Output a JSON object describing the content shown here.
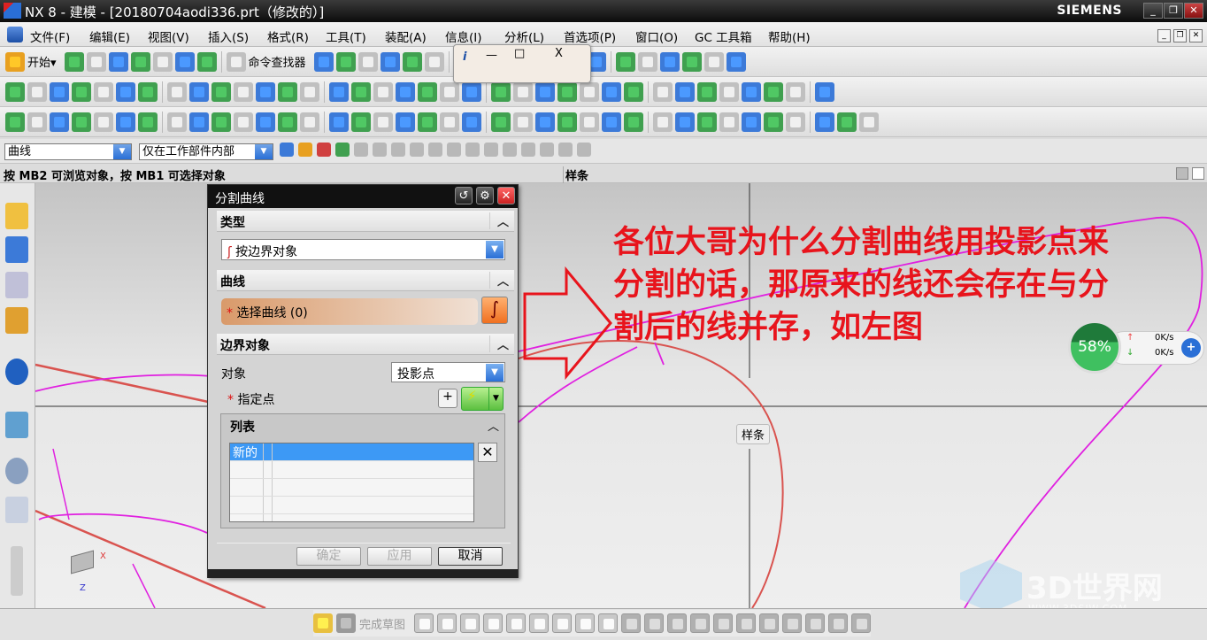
{
  "window": {
    "title": "NX 8 - 建模 - [20180704aodi336.prt（修改的）]",
    "brand": "SIEMENS",
    "min": "_",
    "max": "❐",
    "close": "✕"
  },
  "menu": [
    "文件(F)",
    "编辑(E)",
    "视图(V)",
    "插入(S)",
    "格式(R)",
    "工具(T)",
    "装配(A)",
    "信息(I)",
    "分析(L)",
    "首选项(P)",
    "窗口(O)",
    "GC 工具箱",
    "帮助(H)"
  ],
  "toolbar1": {
    "start": "开始▾",
    "finder": "命令查找器",
    "icons": [
      "new-icon",
      "open-icon",
      "save-icon",
      "save-as-icon",
      "cut-icon",
      "undo-icon",
      "redo-icon",
      "finder-icon",
      "sketch-icon",
      "line-icon",
      "arc-icon",
      "point-icon",
      "rect-icon",
      "spline-icon",
      "wave-icon",
      "polyline-icon",
      "polygon-icon",
      "curve-icon",
      "offset-icon",
      "trim-icon",
      "extend-icon",
      "project-icon",
      "bridge-icon",
      "chamfer-icon",
      "extrude-icon",
      "revolve-icon",
      "sweep-icon"
    ]
  },
  "toolbar2": {
    "icons": [
      "fit-icon",
      "shade-icon",
      "view-icon",
      "render-icon",
      "cube-icon",
      "cube2-icon",
      "cube3-icon",
      "layer-icon",
      "orient-icon",
      "wcs-icon",
      "surface-icon",
      "mesh-icon",
      "grid-icon",
      "swept-icon",
      "ruled-icon",
      "through-icon",
      "bound-icon",
      "patch-icon",
      "trim-surf-icon",
      "sew-icon",
      "layer2-icon",
      "layer3-icon",
      "section-icon",
      "analysis-icon",
      "move-icon",
      "rotate-icon",
      "mirror-icon",
      "scale-icon",
      "transform-icon",
      "measure-icon",
      "box-icon",
      "feature-icon",
      "feature2-icon",
      "feature3-icon",
      "feature4-icon",
      "feature5-icon"
    ]
  },
  "toolbar3": {
    "icons": [
      "curve-analyze-icon",
      "hole-icon",
      "pattern-icon",
      "stack-icon",
      "stack2-icon",
      "stack3-icon",
      "block-icon",
      "boolean-icon",
      "doc-icon",
      "door-icon",
      "table-icon",
      "sheet-icon",
      "box2-icon",
      "solid-icon",
      "blend-icon",
      "thicken-icon",
      "shell-icon",
      "draft-icon",
      "unite-icon",
      "subtract-icon",
      "intersect-icon",
      "sew2-icon",
      "split-icon",
      "offset2-icon",
      "extract-icon",
      "thread-icon",
      "rib-icon",
      "emboss-icon",
      "pad-icon",
      "pocket-icon",
      "slot-icon",
      "groove-icon",
      "boss-icon",
      "face-icon",
      "face2-icon",
      "face3-icon",
      "face4-icon",
      "face5-icon"
    ]
  },
  "selection": {
    "filter": "曲线",
    "scope": "仅在工作部件内部"
  },
  "status": {
    "prompt": "按 MB2 可浏览对象，按 MB1 可选择对象",
    "mode": "样条"
  },
  "floating_toolbar": {
    "info": "i",
    "min": "—",
    "restore": "□",
    "close": "X"
  },
  "dialog": {
    "title": "分割曲线",
    "sections": {
      "type": "类型",
      "curve": "曲线",
      "boundary": "边界对象",
      "list": "列表"
    },
    "type_value": "按边界对象",
    "select_curve": "选择曲线 (0)",
    "object_label": "对象",
    "object_value": "投影点",
    "point_label": "指定点",
    "list_rows": [
      "新的",
      "",
      "",
      "",
      ""
    ],
    "ok": "确定",
    "apply": "应用",
    "cancel": "取消"
  },
  "viewport": {
    "spline_label": "样条",
    "axis_x": "X",
    "axis_z": "Z"
  },
  "annotation": [
    "各位大哥为什么分割曲线用投影点来",
    "分割的话，那原来的线还会存在与分",
    "割后的线并存，如左图"
  ],
  "network": {
    "percent": "58%",
    "up": "0K/s",
    "down": "0K/s"
  },
  "watermark": {
    "name": "3D世界网",
    "url": "WWW.3DSJW.COM"
  },
  "bottom_toolbar": {
    "finish": "完成草图"
  }
}
